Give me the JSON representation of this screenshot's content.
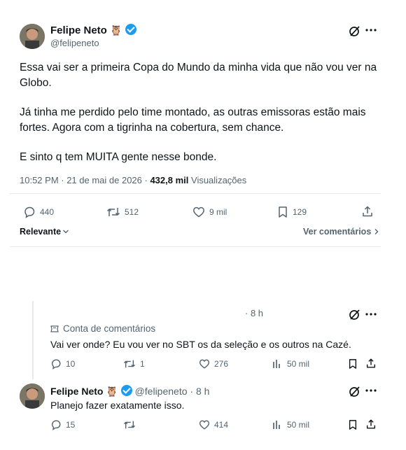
{
  "tweet": {
    "author_name": "Felipe Neto",
    "author_emoji": "🦉",
    "handle": "@felipeneto",
    "paragraphs": [
      "Essa vai ser a primeira Copa do Mundo da minha vida que não vou ver na Globo.",
      "Já tinha me perdido pelo time montado, as outras emissoras estão mais fortes. Agora com a tigrinha na cobertura, sem chance.",
      "E sinto q tem MUITA gente nesse bonde."
    ],
    "time": "10:52 PM · 21 de mai de 2026 · ",
    "views_count": "432,8 mil",
    "views_label": " Visualizações",
    "actions": {
      "replies": "440",
      "reposts": "512",
      "likes": "9 mil",
      "bookmarks": "129"
    },
    "relevance_label": "Relevante",
    "view_comments_label": "Ver comentários"
  },
  "comment1": {
    "time": "· 8 h",
    "account_label": "Conta de comentários",
    "text": "Vai ver onde? Eu vou ver no SBT os da seleção e os outros na Cazé.",
    "actions": {
      "replies": "10",
      "reposts": "1",
      "likes": "276",
      "views": "50 mil"
    }
  },
  "comment2": {
    "author_name": "Felipe Neto",
    "author_emoji": "🦉",
    "handle": "@felipeneto",
    "time": "· 8 h",
    "text": "Planejo fazer exatamente isso.",
    "actions": {
      "replies": "15",
      "likes": "414",
      "views": "50 mil"
    }
  },
  "colors": {
    "text": "#0f1419",
    "muted": "#536471",
    "verified": "#1d9bf0",
    "divider": "#e7e9ea"
  },
  "icons": [
    "grok-icon",
    "more-icon",
    "reply-icon",
    "repost-icon",
    "like-icon",
    "bookmark-icon",
    "share-icon",
    "views-icon",
    "chevron-down-icon",
    "chevron-right-icon",
    "account-icon"
  ]
}
